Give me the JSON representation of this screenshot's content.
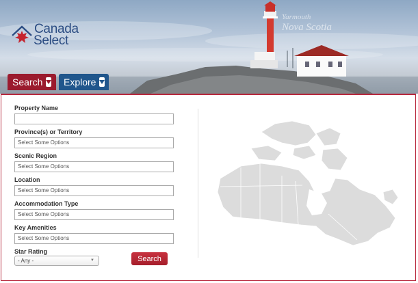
{
  "header": {
    "logo": {
      "line1": "Canada",
      "line2": "Select"
    },
    "location": {
      "city": "Yarmouth",
      "province": "Nova Scotia"
    },
    "tabs": [
      {
        "label": "Search",
        "color": "#9b1b2e"
      },
      {
        "label": "Explore",
        "color": "#20568c"
      }
    ]
  },
  "form": {
    "property_name": {
      "label": "Property Name",
      "value": ""
    },
    "province": {
      "label": "Province(s) or Territory",
      "placeholder": "Select Some Options"
    },
    "scenic_region": {
      "label": "Scenic Region",
      "placeholder": "Select Some Options"
    },
    "location": {
      "label": "Location",
      "placeholder": "Select Some Options"
    },
    "accommodation_type": {
      "label": "Accommodation Type",
      "placeholder": "Select Some Options"
    },
    "key_amenities": {
      "label": "Key Amenities",
      "placeholder": "Select Some Options"
    },
    "star_rating": {
      "label": "Star Rating",
      "selected": "- Any -"
    },
    "submit_label": "Search"
  },
  "colors": {
    "accent_red": "#b7283d",
    "accent_blue": "#20568c",
    "map_fill": "#dcdcdc"
  }
}
